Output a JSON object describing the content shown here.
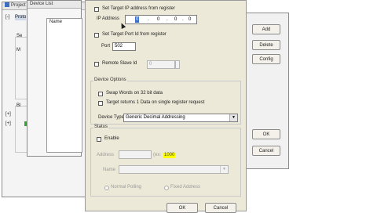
{
  "project_window": {
    "title": "Project N",
    "tree_items": [
      "Proto",
      "[-]",
      "[+]",
      "[+]"
    ],
    "group_labels": [
      "Se",
      "M",
      "Bl"
    ]
  },
  "device_list_window": {
    "title": "Device List",
    "column_header": "Name"
  },
  "right_panel": {
    "add": "Add",
    "delete": "Delete",
    "config": "Config",
    "ok": "OK",
    "cancel": "Cancel"
  },
  "dialog": {
    "use_target_ip_label": "Set Target IP address from register",
    "ip_address_label": "IP Address",
    "ip_octets": [
      "0",
      "0",
      "0",
      "0"
    ],
    "use_target_port_label": "Set Target Port Id from register",
    "port_label": "Port",
    "port_value": "502",
    "remote_slave_label": "Remote Slave Id",
    "remote_slave_value": "0",
    "device_options_title": "Device Options",
    "swap_words_label": "Swap Words on 32 bit data",
    "target_returns_label": "Target returns 1 Data on single register request",
    "device_type_label": "Device Type",
    "device_type_value": "Generic Decimal Addressing",
    "status_title": "Status",
    "enable_label": "Enable",
    "address_label": "Address",
    "address_suffix": "(ex:",
    "address_example": "1000",
    "name_label": "Name",
    "radio1_label": "Normal Polling",
    "radio2_label": "Fixed Address",
    "ok": "OK",
    "cancel": "Cancel"
  },
  "colors": {
    "highlight": "#ffff00",
    "window_bg": "#ece9d8"
  }
}
